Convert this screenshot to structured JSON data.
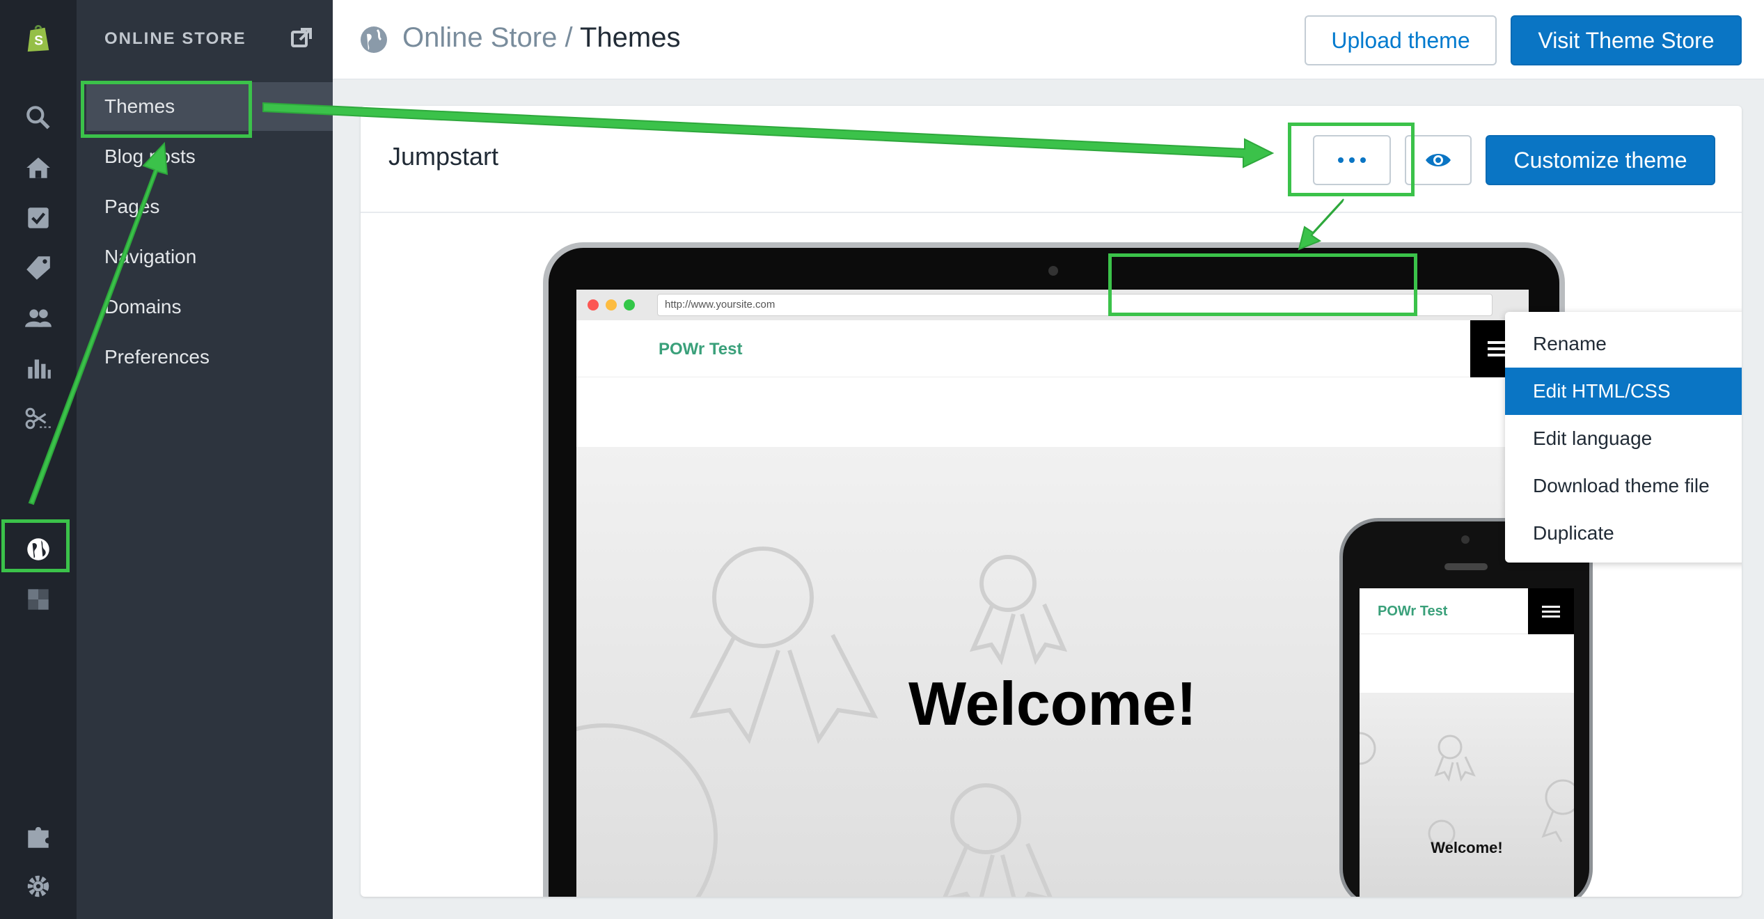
{
  "rail": {
    "icons": [
      "shopify-logo-icon",
      "search-icon",
      "home-icon",
      "orders-icon",
      "products-icon",
      "customers-icon",
      "analytics-icon",
      "discounts-icon",
      "online-store-icon",
      "apps-grid-icon",
      "apps-icon",
      "settings-icon"
    ]
  },
  "subnav": {
    "header": "ONLINE STORE",
    "items": [
      {
        "label": "Themes"
      },
      {
        "label": "Blog posts"
      },
      {
        "label": "Pages"
      },
      {
        "label": "Navigation"
      },
      {
        "label": "Domains"
      },
      {
        "label": "Preferences"
      }
    ]
  },
  "topbar": {
    "breadcrumb_parent": "Online Store",
    "breadcrumb_sep": " / ",
    "breadcrumb_current": "Themes",
    "upload_label": "Upload theme",
    "visit_label": "Visit Theme Store"
  },
  "card": {
    "theme_name": "Jumpstart",
    "customize_label": "Customize theme"
  },
  "dropdown": {
    "items": [
      {
        "label": "Rename"
      },
      {
        "label": "Edit HTML/CSS"
      },
      {
        "label": "Edit language"
      },
      {
        "label": "Download theme file"
      },
      {
        "label": "Duplicate"
      }
    ]
  },
  "preview": {
    "url": "http://www.yoursite.com",
    "site_title": "POWr Test",
    "welcome": "Welcome!",
    "phone_site_title": "POWr Test",
    "phone_welcome": "Welcome!"
  },
  "colors": {
    "accent": "#0a75c4",
    "annotation": "#3bc24a",
    "site_green": "#3aa07a"
  }
}
